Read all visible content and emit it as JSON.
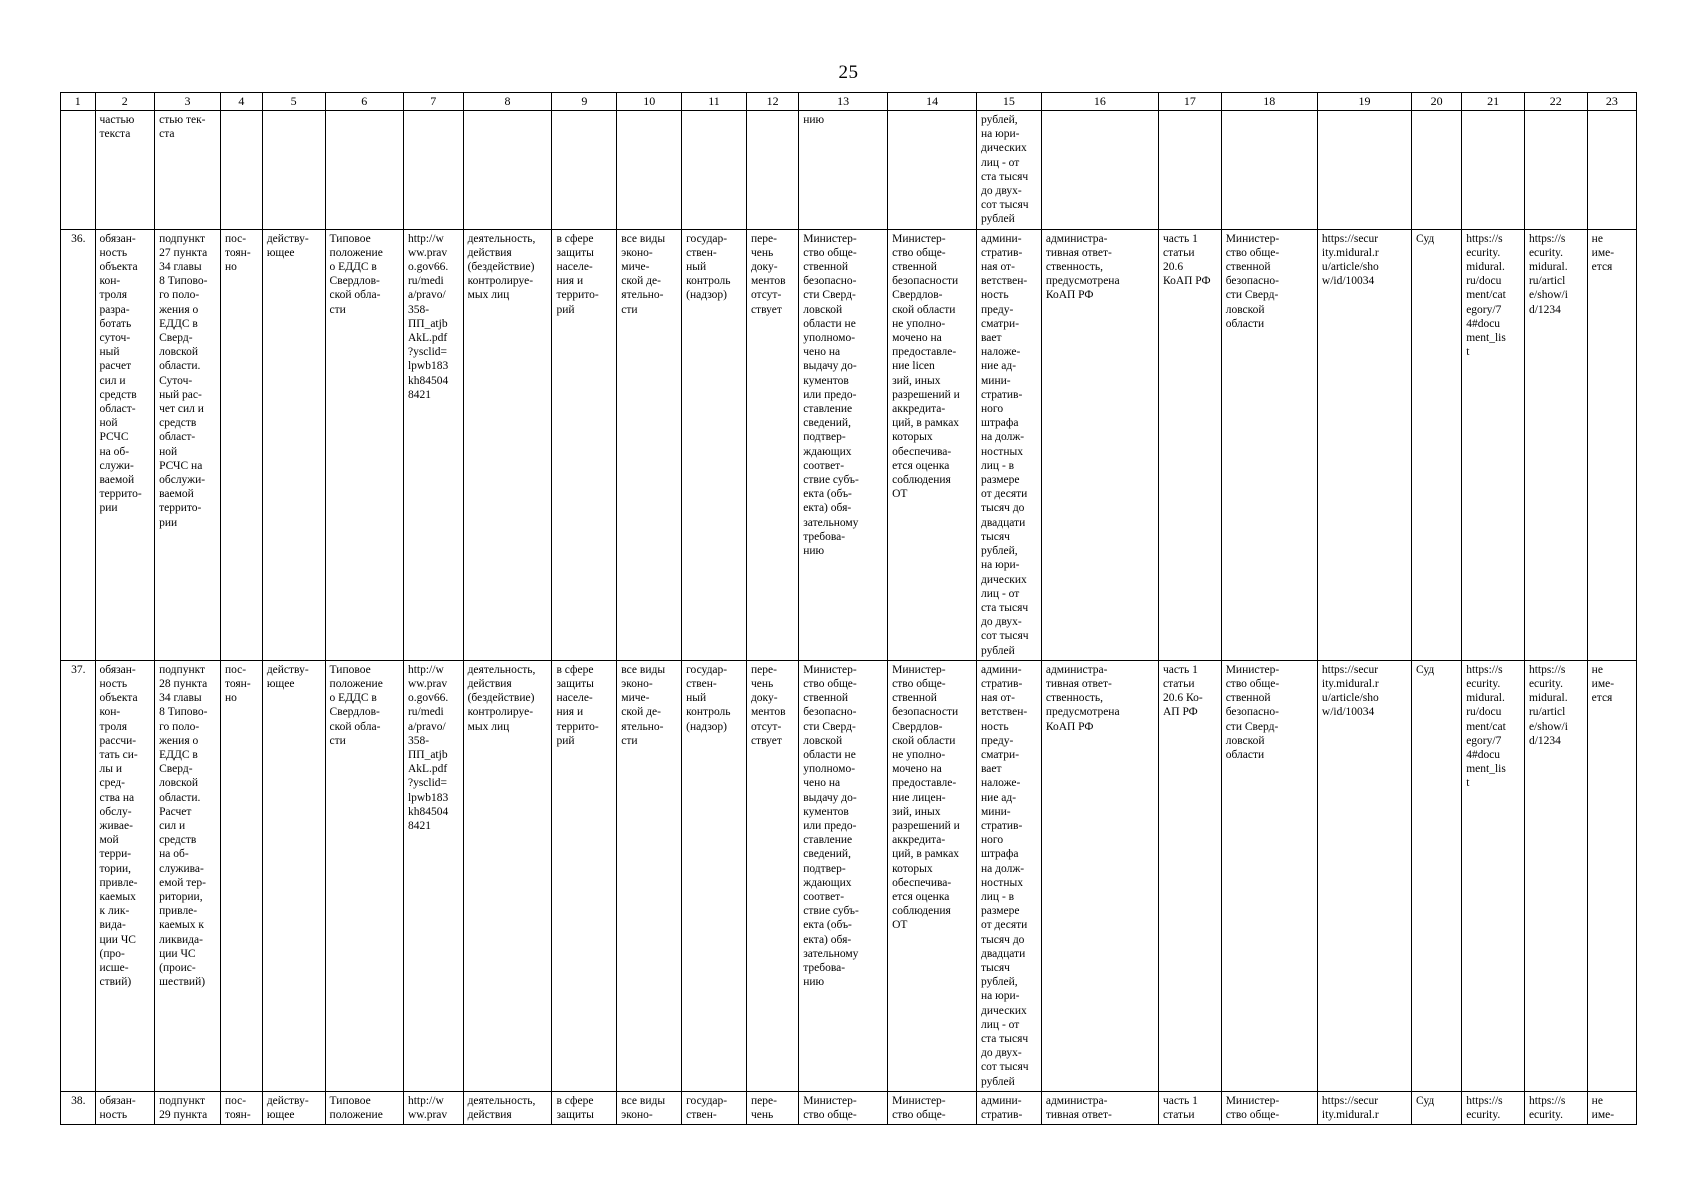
{
  "page": {
    "number": "25"
  },
  "table": {
    "column_headers": [
      "1",
      "2",
      "3",
      "4",
      "5",
      "6",
      "7",
      "8",
      "9",
      "10",
      "11",
      "12",
      "13",
      "14",
      "15",
      "16",
      "17",
      "18",
      "19",
      "20",
      "21",
      "22",
      "23"
    ],
    "rows": [
      {
        "name": "continuation-row",
        "cells": [
          "",
          "частью\nтекста",
          "стью тек-\nста",
          "",
          "",
          "",
          "",
          "",
          "",
          "",
          "",
          "",
          "нию",
          "",
          "рублей,\nна юри-\nдических\nлиц - от\nста тысяч\nдо двух-\nсот тысяч\nрублей",
          "",
          "",
          "",
          "",
          "",
          "",
          "",
          ""
        ]
      },
      {
        "name": "row-36",
        "cells": [
          "36.",
          "обязан-\nность\nобъекта\nкон-\nтроля\nразра-\nботать\nсуточ-\nный\nрасчет\nсил и\nсредств\nобласт-\nной\nРСЧС\nна об-\nслужи-\nваемой\nтеррито-\nрии",
          "подпункт\n27 пункта\n34 главы\n8 Типово-\nго поло-\nжения о\nЕДДС в\nСверд-\nловской\nобласти.\nСуточ-\nный рас-\nчет сил и\nсредств\nобласт-\nной\nРСЧС на\nобслужи-\nваемой\nтеррито-\nрии",
          "пос-\nтоян-\nно",
          "действу-\nющее",
          "Типовое\nположение\nо ЕДДС в\nСвердлов-\nской обла-\nсти",
          "http://w\nww.prav\no.gov66.\nru/medi\na/pravo/\n358-\nПП_atjb\nAkL.pdf\n?ysclid=\nlpwb183\nkh84504\n8421",
          "деятельность,\nдействия\n(бездействие)\nконтролируе-\nмых лиц",
          "в сфере\nзащиты\nнаселе-\nния и\nтеррито-\nрий",
          "все виды\nэконо-\nмиче-\nской де-\nятельно-\nсти",
          "государ-\nствен-\nный\nконтроль\n(надзор)",
          "пере-\nчень\nдоку-\nментов\nотсут-\nствует",
          "Министер-\nство обще-\nственной\nбезопасно-\nсти Сверд-\nловской\nобласти не\nуполномо-\nчено на\nвыдачу до-\nкументов\nили предо-\nставление\nсведений,\nподтвер-\nждающих\nсоответ-\nствие субъ-\nекта (объ-\nекта) обя-\nзательному\nтребова-\nнию",
          "Министер-\nство обще-\nственной\nбезопасности\nСвердлов-\nской области\nне уполно-\nмочено на\nпредоставле-\nние licen\nзий, иных\nразрешений и\nаккредита-\nций, в рамках\nкоторых\nобеспечива-\nется оценка\nсоблюдения\nОТ",
          "админи-\nстратив-\nная от-\nветствен-\nность\nпреду-\nсматри-\nвает\nналоже-\nние ад-\nмини-\nстратив-\nного\nштрафа\nна долж-\nностных\nлиц - в\nразмере\nот десяти\nтысяч до\nдвадцати\nтысяч\nрублей,\nна юри-\nдических\nлиц - от\nста тысяч\nдо двух-\nсот тысяч\nрублей",
          "администра-\nтивная ответ-\nственность,\nпредусмотрена\nКоАП РФ",
          "часть 1\nстатьи\n20.6\nКоАП РФ",
          "Министер-\nство обще-\nственной\nбезопасно-\nсти Сверд-\nловской\nобласти",
          "https://secur\nity.midural.r\nu/article/sho\nw/id/10034",
          "Суд",
          "https://s\necurity.\nmidural.\nru/docu\nment/cat\negory/7\n4#docu\nment_lis\nt",
          "https://s\necurity.\nmidural.\nru/articl\ne/show/i\nd/1234",
          "не\nиме-\nется"
        ]
      },
      {
        "name": "row-37",
        "cells": [
          "37.",
          "обязан-\nность\nобъекта\nкон-\nтроля\nрассчи-\nтать си-\nлы и\nсред-\nства на\nобслу-\nживае-\nмой\nтерри-\nтории,\nпривле-\nкаемых\nк лик-\nвида-\nции ЧС\n(про-\nисше-\nствий)",
          "подпункт\n28 пункта\n34 главы\n8 Типово-\nго поло-\nжения о\nЕДДС в\nСверд-\nловской\nобласти.\nРасчет\nсил и\nсредств\nна об-\nслужива-\nемой тер-\nритории,\nпривле-\nкаемых к\nликвида-\nции ЧС\n(проис-\nшествий)",
          "пос-\nтоян-\nно",
          "действу-\nющее",
          "Типовое\nположение\nо ЕДДС в\nСвердлов-\nской обла-\nсти",
          "http://w\nww.prav\no.gov66.\nru/medi\na/pravo/\n358-\nПП_atjb\nAkL.pdf\n?ysclid=\nlpwb183\nkh84504\n8421",
          "деятельность,\nдействия\n(бездействие)\nконтролируе-\nмых лиц",
          "в сфере\nзащиты\nнаселе-\nния и\nтеррито-\nрий",
          "все виды\nэконо-\nмиче-\nской де-\nятельно-\nсти",
          "государ-\nствен-\nный\nконтроль\n(надзор)",
          "пере-\nчень\nдоку-\nментов\nотсут-\nствует",
          "Министер-\nство обще-\nственной\nбезопасно-\nсти Сверд-\nловской\nобласти не\nуполномо-\nчено на\nвыдачу до-\nкументов\nили предо-\nставление\nсведений,\nподтвер-\nждающих\nсоответ-\nствие субъ-\nекта (объ-\nекта) обя-\nзательному\nтребова-\nнию",
          "Министер-\nство обще-\nственной\nбезопасности\nСвердлов-\nской области\nне уполно-\nмочено на\nпредоставле-\nние лицен-\nзий, иных\nразрешений и\nаккредита-\nций, в рамках\nкоторых\nобеспечива-\nется оценка\nсоблюдения\nОТ",
          "админи-\nстратив-\nная от-\nветствен-\nность\nпреду-\nсматри-\nвает\nналоже-\nние ад-\nмини-\nстратив-\nного\nштрафа\nна долж-\nностных\nлиц - в\nразмере\nот десяти\nтысяч до\nдвадцати\nтысяч\nрублей,\nна юри-\nдических\nлиц - от\nста тысяч\nдо двух-\nсот тысяч\nрублей",
          "администра-\nтивная ответ-\nственность,\nпредусмотрена\nКоАП РФ",
          "часть 1\nстатьи\n20.6 Ко-\nАП РФ",
          "Министер-\nство обще-\nственной\nбезопасно-\nсти Сверд-\nловской\nобласти",
          "https://secur\nity.midural.r\nu/article/sho\nw/id/10034",
          "Суд",
          "https://s\necurity.\nmidural.\nru/docu\nment/cat\negory/7\n4#docu\nment_lis\nt",
          "https://s\necurity.\nmidural.\nru/articl\ne/show/i\nd/1234",
          "не\nиме-\nется"
        ]
      },
      {
        "name": "row-38",
        "cells": [
          "38.",
          "обязан-\nность",
          "подпункт\n29 пункта",
          "пос-\nтоян-",
          "действу-\nющее",
          "Типовое\nположение",
          "http://w\nww.prav",
          "деятельность,\nдействия",
          "в сфере\nзащиты",
          "все виды\nэконо-",
          "государ-\nствен-",
          "пере-\nчень",
          "Министер-\nство обще-",
          "Министер-\nство обще-",
          "админи-\nстратив-",
          "администра-\nтивная ответ-",
          "часть 1\nстатьи",
          "Министер-\nство обще-",
          "https://secur\nity.midural.r",
          "Суд",
          "https://s\necurity.",
          "https://s\necurity.",
          "не\nиме-"
        ]
      }
    ]
  }
}
